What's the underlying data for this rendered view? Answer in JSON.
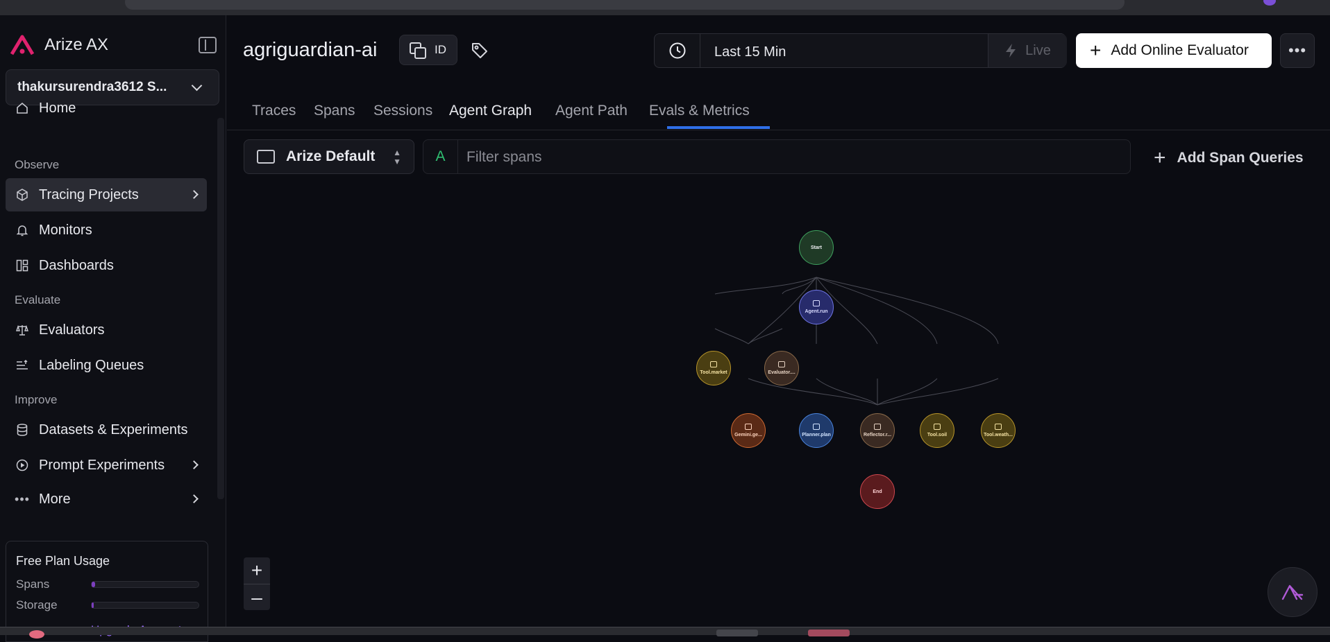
{
  "app": {
    "name": "Arize AX",
    "org": "thakursurendra3612 S..."
  },
  "sidebar": {
    "home": "Home",
    "sections": {
      "observe": "Observe",
      "evaluate": "Evaluate",
      "improve": "Improve"
    },
    "items": {
      "tracing": "Tracing Projects",
      "monitors": "Monitors",
      "dashboards": "Dashboards",
      "evaluators": "Evaluators",
      "labeling": "Labeling Queues",
      "datasets": "Datasets & Experiments",
      "prompt": "Prompt Experiments",
      "more": "More"
    },
    "usage": {
      "title": "Free Plan Usage",
      "spans_label": "Spans",
      "storage_label": "Storage",
      "spans_fraction": 0.03,
      "storage_fraction": 0.02,
      "upgrade": "Upgrade Account"
    }
  },
  "header": {
    "project": "agriguardian-ai",
    "id_label": "ID",
    "time_range": "Last 15 Min",
    "live_label": "Live",
    "add_eval": "Add Online Evaluator",
    "more_icon": "ellipsis-icon"
  },
  "tabs": [
    "Traces",
    "Spans",
    "Sessions",
    "Agent Graph",
    "Agent Path",
    "Evals & Metrics"
  ],
  "active_tab": "Agent Graph",
  "filter": {
    "view": "Arize Default",
    "prefix": "A",
    "placeholder": "Filter spans",
    "add_queries": "Add Span Queries"
  },
  "graph": {
    "nodes": {
      "start": "Start",
      "agent": "Agent.run",
      "tool_market": "Tool.market",
      "evaluator": "Evaluator....",
      "gemini": "Gemini.ge...",
      "planner": "Planner.plan",
      "reflector": "Reflector.r...",
      "tool_soil": "Tool.soil",
      "tool_weather": "Tool.weath...",
      "end": "End"
    },
    "zoom_in": "+",
    "zoom_out": "–"
  },
  "colors": {
    "accent": "#2f6fe8",
    "brand": "#e0226e",
    "start": "#1f3a26",
    "agent": "#272b6b",
    "tool": "#4a3e12",
    "gemini": "#5a2a16",
    "planner": "#1f3a6b",
    "reflector": "#3a2a22",
    "end": "#5a1b1e"
  }
}
